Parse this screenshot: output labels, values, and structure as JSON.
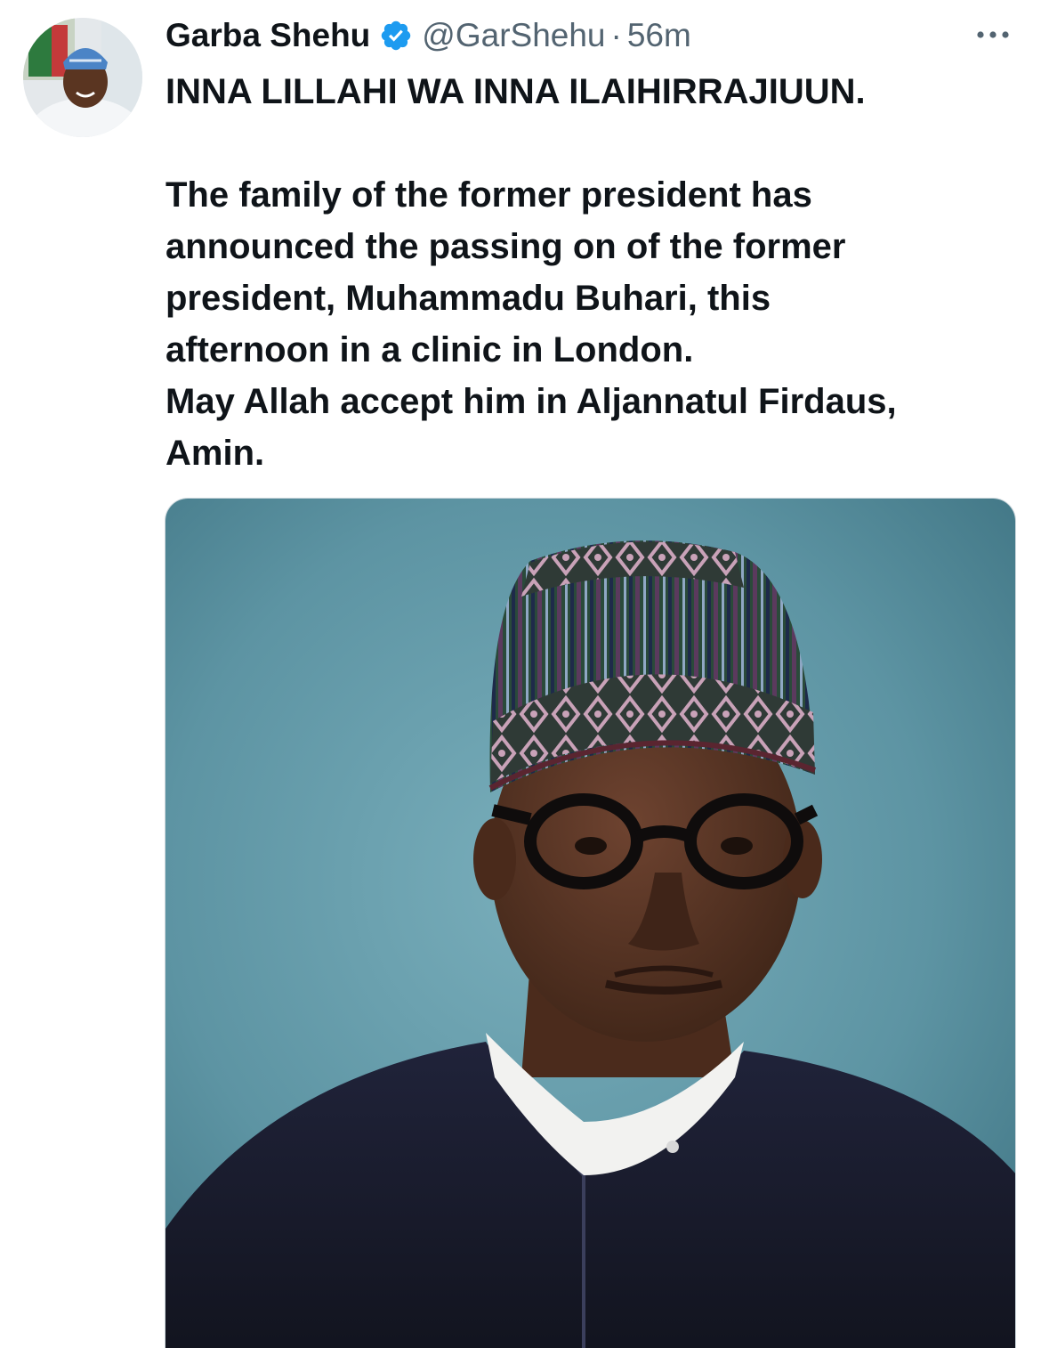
{
  "tweet": {
    "author_name": "Garba Shehu",
    "handle": "@GarShehu",
    "separator": "·",
    "timestamp": "56m",
    "verified": true,
    "text_lines": [
      "INNA LILLAHI WA INNA ILAIHIRRAJIUUN.",
      "",
      "The family of the former president has",
      "announced the passing on of the former",
      "president, Muhammadu Buhari, this",
      "afternoon in a clinic in London.",
      "May Allah accept him in Aljannatul Firdaus,",
      "Amin."
    ]
  },
  "icons": {
    "verified": "verified-badge-icon",
    "more": "more-options-icon"
  },
  "colors": {
    "text_primary": "#0f1419",
    "text_secondary": "#536471",
    "verified_blue": "#1d9bf0",
    "photo_background": "#5f97a6"
  }
}
